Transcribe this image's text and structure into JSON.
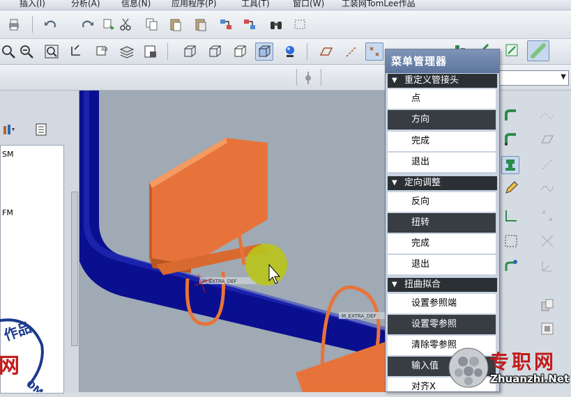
{
  "menubar": {
    "items": [
      "插入(I)",
      "分析(A)",
      "信息(N)",
      "应用程序(P)",
      "工具(T)",
      "窗口(W)",
      "工装网TomLee作品"
    ]
  },
  "filter": {
    "value": ""
  },
  "menu_manager": {
    "title": "菜单管理器",
    "sections": [
      {
        "header": "重定义管接头",
        "items": [
          {
            "label": "点",
            "highlight": false
          },
          {
            "label": "方向",
            "highlight": true
          },
          {
            "label": "完成",
            "highlight": false
          },
          {
            "label": "退出",
            "highlight": false
          }
        ]
      },
      {
        "header": "定向调整",
        "items": [
          {
            "label": "反向",
            "highlight": false
          },
          {
            "label": "扭转",
            "highlight": true
          },
          {
            "label": "完成",
            "highlight": false
          },
          {
            "label": "退出",
            "highlight": false
          }
        ]
      },
      {
        "header": "扭曲拟合",
        "items": [
          {
            "label": "设置参照端",
            "highlight": false
          },
          {
            "label": "设置零参照",
            "highlight": true
          },
          {
            "label": "清除零参照",
            "highlight": false
          },
          {
            "label": "输入值",
            "highlight": true
          },
          {
            "label": "对齐X",
            "highlight": false
          }
        ]
      }
    ]
  },
  "left_panel": {
    "items": [
      "SM",
      "FM"
    ]
  },
  "viewport": {
    "labels": [
      "M_EXTRA_DEF",
      "M_EXTRA_DEF"
    ]
  },
  "watermark": {
    "name": "专职网",
    "url": "Zhuanzhi.Net",
    "side_text": "作品",
    "side_text2": "OM"
  },
  "colors": {
    "pipe": "#0a0f8f",
    "bracket": "#e8733a",
    "viewport_bg": "#9faab4",
    "menu_highlight": "#373d43"
  }
}
